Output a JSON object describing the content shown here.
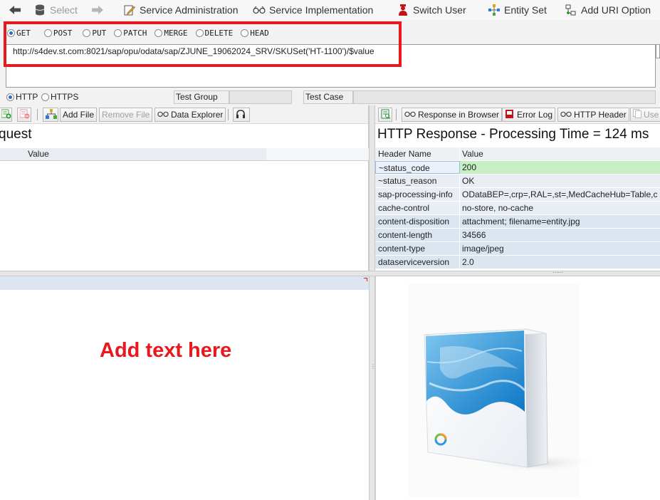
{
  "toolbar": {
    "select_label": "Select",
    "service_admin_label": "Service Administration",
    "service_impl_label": "Service Implementation",
    "switch_user_label": "Switch User",
    "entity_set_label": "Entity Set",
    "add_uri_label": "Add URI Option"
  },
  "methods": [
    "GET",
    "POST",
    "PUT",
    "PATCH",
    "MERGE",
    "DELETE",
    "HEAD"
  ],
  "selected_method": "GET",
  "url": "http://s4dev.st.com:8021/sap/opu/odata/sap/ZJUNE_19062024_SRV/SKUSet('HT-1100')/$value",
  "protocol": {
    "http_label": "HTTP",
    "https_label": "HTTPS",
    "test_group_label": "Test Group",
    "test_case_label": "Test Case"
  },
  "request_panel": {
    "add_file_label": "Add File",
    "remove_file_label": "Remove File",
    "data_explorer_label": "Data Explorer",
    "title": "quest",
    "column_value": "Value"
  },
  "response_panel": {
    "response_in_browser_label": "Response in Browser",
    "error_log_label": "Error Log",
    "http_header_label": "HTTP Header",
    "use_label": "Use",
    "title": "HTTP Response - Processing Time = 124  ms",
    "col_header_name": "Header Name",
    "col_value": "Value",
    "headers": [
      {
        "name": "~status_code",
        "value": "200"
      },
      {
        "name": "~status_reason",
        "value": "OK"
      },
      {
        "name": "sap-processing-info",
        "value": "ODataBEP=,crp=,RAL=,st=,MedCacheHub=Table,c"
      },
      {
        "name": "cache-control",
        "value": "no-store, no-cache"
      },
      {
        "name": "content-disposition",
        "value": "attachment; filename=entity.jpg"
      },
      {
        "name": "content-length",
        "value": "34566"
      },
      {
        "name": "content-type",
        "value": "image/jpeg"
      },
      {
        "name": "dataserviceversion",
        "value": "2.0"
      }
    ]
  },
  "annotation": {
    "add_text": "Add text here"
  },
  "colors": {
    "highlight_red": "#e8191c",
    "status_ok_green": "#c6f0c4",
    "row_blue": "#dce6f1"
  }
}
